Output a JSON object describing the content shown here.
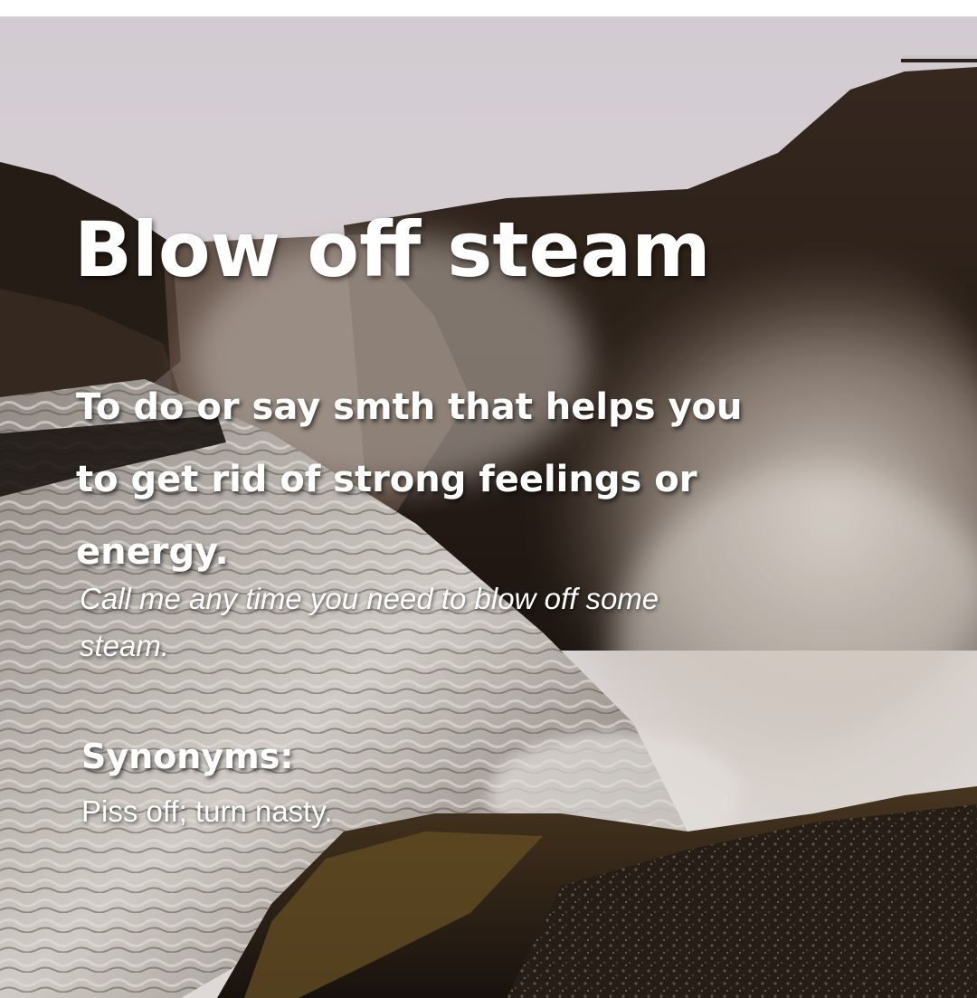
{
  "card": {
    "title": "Blow off steam",
    "definition_lines": [
      "To do or say smth that helps you",
      "to get rid of strong feelings or",
      "energy."
    ],
    "example_lines": [
      "Call me any time you need to blow off some",
      "steam."
    ],
    "synonyms_heading": "Synonyms:",
    "synonyms": "Piss off; turn nasty."
  },
  "background": {
    "icon": "waterfall-canyon-photo",
    "colors": {
      "sky": "#eae3e6",
      "cliff": "#3a2c22",
      "mist": "#d9cfc8",
      "water": "#cfc9c4",
      "moss": "#5a4420"
    }
  }
}
